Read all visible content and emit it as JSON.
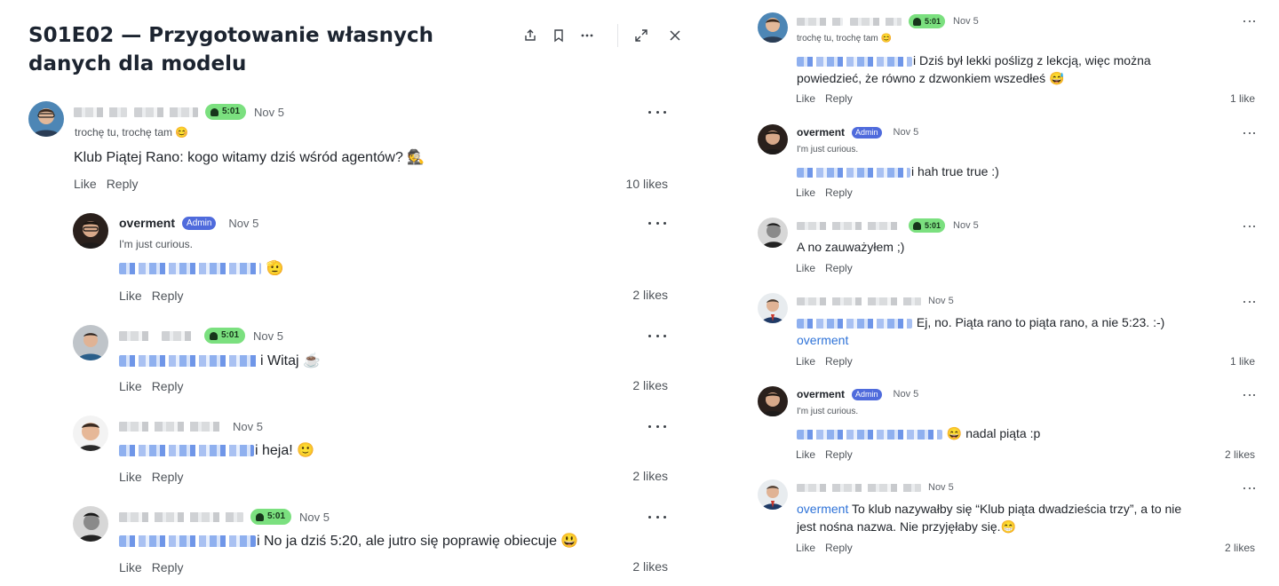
{
  "thread": {
    "title": "S01E02 — Przygotowanie własnych danych dla modelu"
  },
  "toolbar": {
    "icons": [
      "share-icon",
      "bookmark-icon",
      "more-icon",
      "expand-icon",
      "close-icon"
    ]
  },
  "colors": {
    "admin_badge": "#4f6bdc",
    "rank_badge": "#7be07f",
    "link": "#2f73d8"
  },
  "left_comments": [
    {
      "rank": "5:01",
      "date": "Nov 5",
      "sub": "trochę tu, trochę tam 😊",
      "text": "Klub Piątej Rano: kogo witamy dziś wśród agentów? 🕵️",
      "like": "Like",
      "reply": "Reply",
      "likes": "10 likes"
    },
    {
      "name": "overment",
      "badge": "Admin",
      "date": "Nov 5",
      "sub": "I'm just curious.",
      "text": "🫡",
      "like": "Like",
      "reply": "Reply",
      "likes": "2 likes"
    },
    {
      "rank": "5:01",
      "date": "Nov 5",
      "text": "i Witaj ☕",
      "like": "Like",
      "reply": "Reply",
      "likes": "2 likes"
    },
    {
      "date": "Nov 5",
      "text": "i heja! 🙂",
      "like": "Like",
      "reply": "Reply",
      "likes": "2 likes"
    },
    {
      "rank": "5:01",
      "date": "Nov 5",
      "text": "i No ja dziś 5:20, ale jutro się poprawię obiecuje 😃",
      "like": "Like",
      "reply": "Reply",
      "likes": "2 likes"
    }
  ],
  "right_comments": [
    {
      "rank": "5:01",
      "date": "Nov 5",
      "sub": "trochę tu, trochę tam 😊",
      "text": "i Dziś był lekki poślizg z lekcją, więc można powiedzieć, że równo z dzwonkiem wszedłeś 😅",
      "like": "Like",
      "reply": "Reply",
      "likes": "1 like"
    },
    {
      "name": "overment",
      "badge": "Admin",
      "date": "Nov 5",
      "sub": "I'm just curious.",
      "text": "i hah true true :)",
      "like": "Like",
      "reply": "Reply"
    },
    {
      "rank": "5:01",
      "date": "Nov 5",
      "text": "A no zauważyłem ;)",
      "like": "Like",
      "reply": "Reply"
    },
    {
      "date": "Nov 5",
      "text": "Ej, no. Piąta rano to piąta rano, a nie 5:23. :-)",
      "mention": "overment",
      "like": "Like",
      "reply": "Reply",
      "likes": "1 like"
    },
    {
      "name": "overment",
      "badge": "Admin",
      "date": "Nov 5",
      "sub": "I'm just curious.",
      "text": "😄 nadal piąta :p",
      "like": "Like",
      "reply": "Reply",
      "likes": "2 likes"
    },
    {
      "date": "Nov 5",
      "mention": "overment",
      "text": "To klub nazywałby się “Klub piąta dwadzieścia trzy”, a to nie jest nośna nazwa. Nie przyjęłaby się.😁",
      "like": "Like",
      "reply": "Reply",
      "likes": "2 likes"
    }
  ]
}
